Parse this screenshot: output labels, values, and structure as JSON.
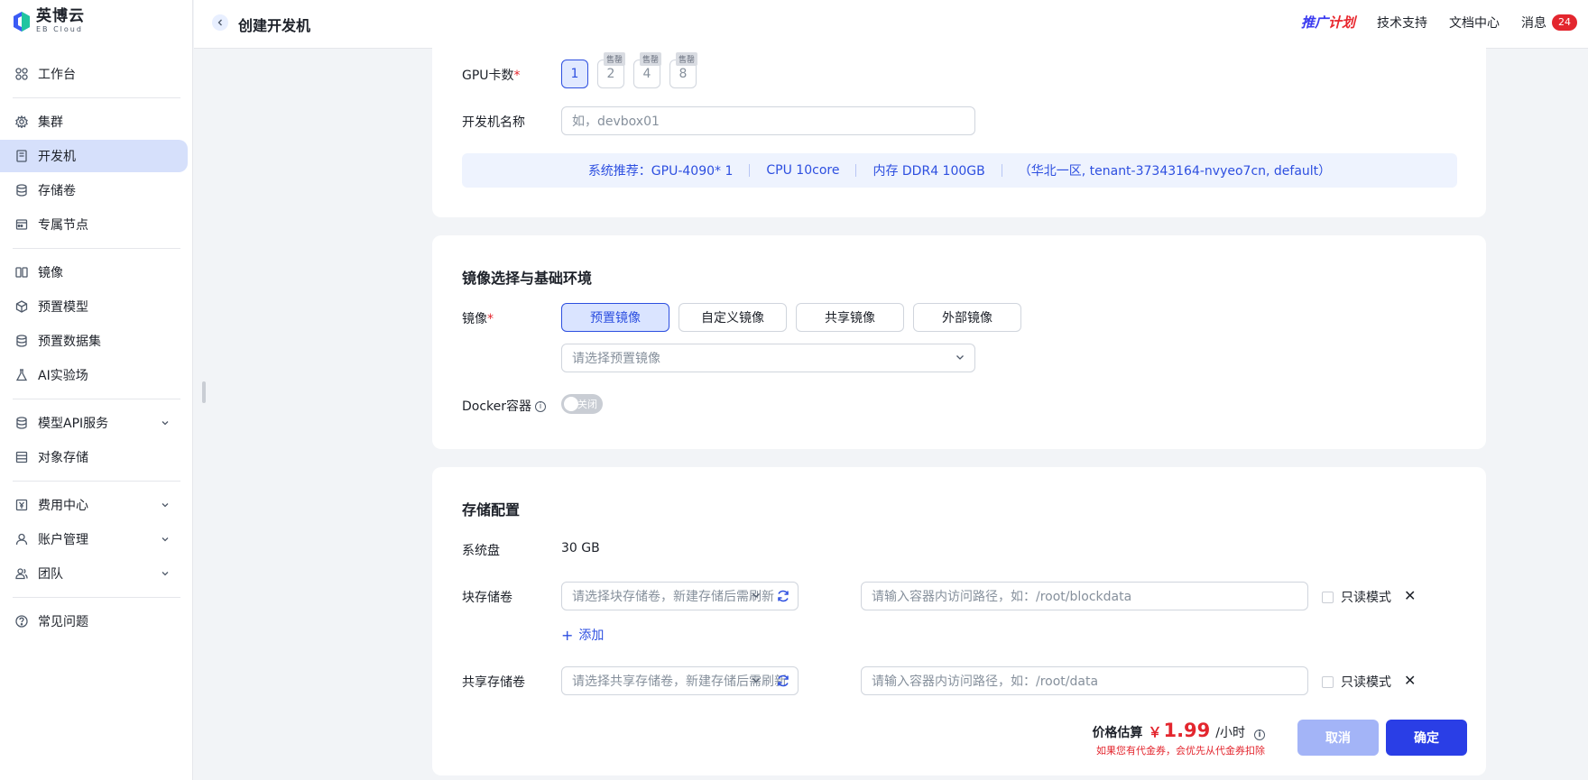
{
  "brand": {
    "name_cn": "英博云",
    "name_en": "EB Cloud"
  },
  "sidebar": {
    "items": [
      {
        "label": "工作台",
        "icon": "grid-icon"
      },
      {
        "label": "集群",
        "icon": "gear-icon"
      },
      {
        "label": "开发机",
        "icon": "devbox-icon"
      },
      {
        "label": "存储卷",
        "icon": "database-icon"
      },
      {
        "label": "专属节点",
        "icon": "node-icon"
      },
      {
        "label": "镜像",
        "icon": "image-icon"
      },
      {
        "label": "预置模型",
        "icon": "cube-icon"
      },
      {
        "label": "预置数据集",
        "icon": "dataset-icon"
      },
      {
        "label": "AI实验场",
        "icon": "flask-icon"
      },
      {
        "label": "模型API服务",
        "icon": "api-icon"
      },
      {
        "label": "对象存储",
        "icon": "storage-icon"
      },
      {
        "label": "费用中心",
        "icon": "yen-icon"
      },
      {
        "label": "账户管理",
        "icon": "user-icon"
      },
      {
        "label": "团队",
        "icon": "team-icon"
      },
      {
        "label": "常见问题",
        "icon": "question-icon"
      }
    ]
  },
  "header": {
    "title": "创建开发机",
    "promo_a": "推广",
    "promo_b": "计划",
    "support": "技术支持",
    "docs": "文档中心",
    "messages": "消息",
    "message_count": "24"
  },
  "config": {
    "gpu_label": "GPU卡数",
    "gpu_options": [
      "1",
      "2",
      "4",
      "8"
    ],
    "sold_out": "售罄",
    "name_label": "开发机名称",
    "name_placeholder": "如，devbox01",
    "recommend_gpu": "系统推荐：GPU-4090* 1",
    "recommend_cpu": "CPU 10core",
    "recommend_mem": "内存 DDR4 100GB",
    "recommend_region": "（华北一区, tenant-37343164-nvyeo7cn, default）"
  },
  "image": {
    "section_title": "镜像选择与基础环境",
    "label": "镜像",
    "tabs": [
      "预置镜像",
      "自定义镜像",
      "共享镜像",
      "外部镜像"
    ],
    "select_placeholder": "请选择预置镜像",
    "docker_label": "Docker容器",
    "docker_state": "关闭"
  },
  "storage": {
    "section_title": "存储配置",
    "system_disk_label": "系统盘",
    "system_disk_value": "30 GB",
    "block_label": "块存储卷",
    "block_placeholder": "请选择块存储卷，新建存储后需刷新",
    "block_path_placeholder": "请输入容器内访问路径，如：/root/blockdata",
    "readonly_label": "只读模式",
    "add_label": "添加",
    "shared_label": "共享存储卷",
    "shared_placeholder": "请选择共享存储卷，新建存储后需刷新",
    "shared_path_placeholder": "请输入容器内访问路径，如：/root/data"
  },
  "footer": {
    "price_label": "价格估算",
    "currency": "￥",
    "price": "1.99",
    "unit": "/小时",
    "note": "如果您有代金券，会优先从代金券扣除",
    "cancel": "取消",
    "confirm": "确定"
  },
  "colors": {
    "accent": "#2a3ee6",
    "active_nav": "#d6e0fb",
    "danger": "#e3262e"
  }
}
